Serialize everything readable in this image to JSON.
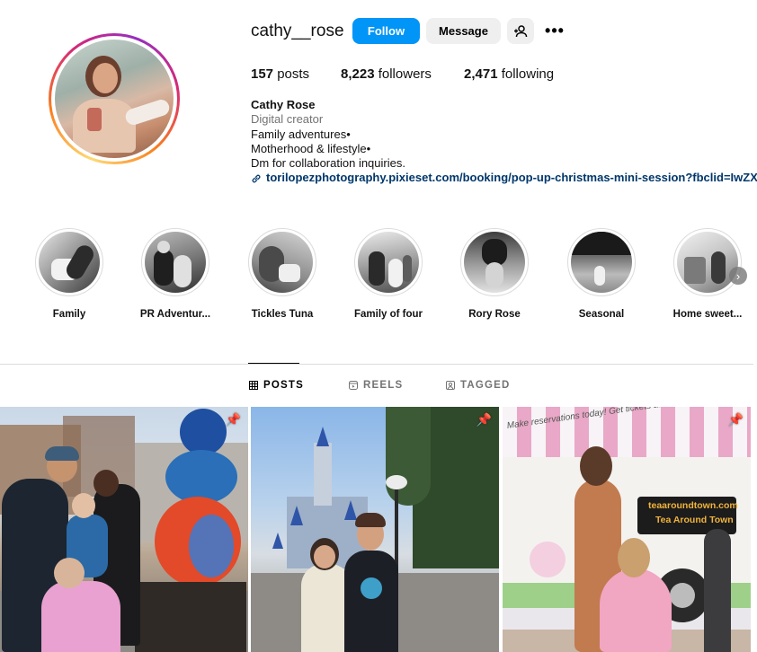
{
  "profile": {
    "username": "cathy__rose",
    "buttons": {
      "follow": "Follow",
      "message": "Message",
      "add_user_icon": "add-user-icon",
      "more_icon": "more-icon",
      "more_glyph": "•••"
    },
    "stats": {
      "posts_count": "157",
      "posts_label": "posts",
      "followers_count": "8,223",
      "followers_label": "followers",
      "following_count": "2,471",
      "following_label": "following"
    },
    "bio": {
      "name": "Cathy Rose",
      "category": "Digital creator",
      "lines": [
        "Family adventures•",
        "Motherhood & lifestyle•",
        "Dm for collaboration inquiries."
      ],
      "link": "torilopezphotography.pixieset.com/booking/pop-up-christmas-mini-session?fbclid=IwZX"
    }
  },
  "highlights": [
    {
      "label": "Family"
    },
    {
      "label": "PR Adventur..."
    },
    {
      "label": "Tickles Tuna"
    },
    {
      "label": "Family of four"
    },
    {
      "label": "Rory Rose"
    },
    {
      "label": "Seasonal"
    },
    {
      "label": "Home sweet..."
    }
  ],
  "tabs": [
    {
      "label": "POSTS",
      "icon": "grid-icon",
      "active": true
    },
    {
      "label": "REELS",
      "icon": "reels-icon",
      "active": false
    },
    {
      "label": "TAGGED",
      "icon": "tagged-icon",
      "active": false
    }
  ],
  "posts": [
    {
      "pinned": true,
      "pin_icon": "pin-icon"
    },
    {
      "pinned": true,
      "pin_icon": "pin-icon"
    },
    {
      "pinned": true,
      "pin_icon": "pin-icon",
      "awning_text": "Make reservations today! Get tickets at",
      "sign_line1": "teaaroundtown.com",
      "sign_line2": "Tea Around Town"
    }
  ],
  "colors": {
    "follow_blue": "#0095f6",
    "link_blue": "#00376b",
    "muted_gray": "#737373",
    "button_gray": "#efefef"
  }
}
